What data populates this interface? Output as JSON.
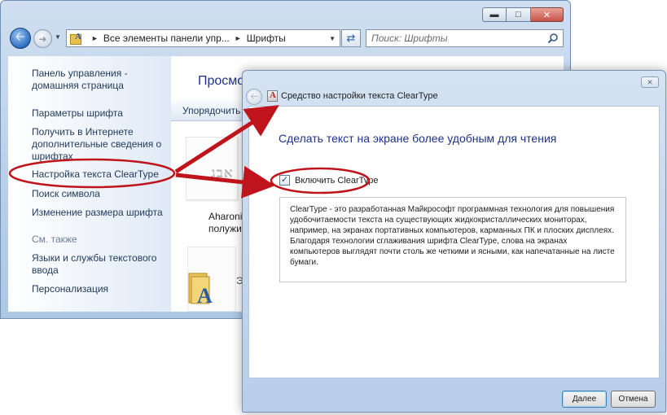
{
  "control_panel": {
    "address_crumbs": [
      "Все элементы панели упр...",
      "Шрифты"
    ],
    "search_placeholder": "Поиск: Шрифты",
    "sidebar": {
      "home_link": "Панель управления -\nдомашняя страница",
      "links": [
        "Параметры шрифта",
        "Получить в Интернете\nдополнительные сведения о\nшрифтах",
        "Настройка текста ClearType",
        "Поиск символа",
        "Изменение размера шрифта"
      ],
      "see_also_label": "См. также",
      "see_also_links": [
        "Языки и службы текстового\nввода",
        "Персонализация"
      ]
    },
    "content": {
      "heading": "Просмо",
      "toolbar_organize": "Упорядочить",
      "font_tile_glyph": "אבג",
      "font_name": "Aharoni\nполужирн",
      "partial_item": "Э"
    }
  },
  "cleartype_window": {
    "title": "Средство настройки текста ClearType",
    "heading": "Сделать текст на экране более удобным для чтения",
    "checkbox_label": "Включить ClearType",
    "checkbox_checked": true,
    "description": "ClearType - это разработанная Майкрософт программная технология для повышения удобочитаемости текста на существующих жидкокристаллических мониторах, например, на экранах портативных компьютеров, карманных ПК и плоских дисплеях. Благодаря технологии сглаживания шрифта ClearType, слова на экранах компьютеров выглядят почти столь же четкими и ясными, как напечатанные на листе бумаги.",
    "next_button": "Далее",
    "cancel_button": "Отмена"
  },
  "annotation_color": "#c0141c",
  "icons": {
    "back": "back-arrow-icon",
    "forward": "forward-arrow-icon",
    "refresh": "refresh-icon",
    "search": "search-icon",
    "fonts_folder": "fonts-folder-icon",
    "cleartype_app": "cleartype-app-icon"
  }
}
